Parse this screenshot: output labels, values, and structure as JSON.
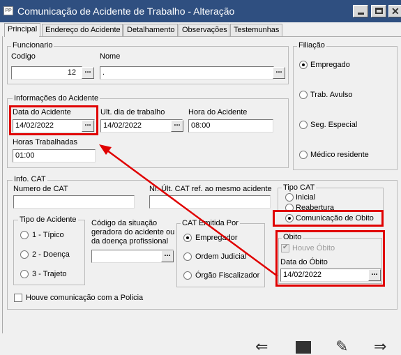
{
  "window": {
    "icon": "PP",
    "title": "Comunicação de Acidente de Trabalho - Alteração",
    "colors": {
      "titlebar": "#2f4f80",
      "highlight": "#e00000"
    }
  },
  "tabs": [
    "Principal",
    "Endereço do Acidente",
    "Detalhamento",
    "Observações",
    "Testemunhas"
  ],
  "funcionario": {
    "title": "Funcionario",
    "codigo_label": "Codigo",
    "codigo_value": "12",
    "nome_label": "Nome",
    "nome_value": "."
  },
  "filiacao": {
    "title": "Filiação",
    "options": [
      "Empregado",
      "Trab. Avulso",
      "Seg. Especial",
      "Médico residente"
    ],
    "selected": "Empregado"
  },
  "informacoes": {
    "title": "Informações do Acidente",
    "data_label": "Data do Acidente",
    "data_value": "14/02/2022",
    "ult_label": "Ult. dia de trabalho",
    "ult_value": "14/02/2022",
    "hora_label": "Hora do Acidente",
    "hora_value": "08:00",
    "horas_label": "Horas Trabalhadas",
    "horas_value": "01:00"
  },
  "info_cat": {
    "title": "Info. CAT",
    "numero_label": "Numero de CAT",
    "numero_value": "",
    "nr_label": "Nr. Últ. CAT ref. ao mesmo acidente",
    "nr_value": "",
    "tipo_acidente": {
      "title": "Tipo de Acidente",
      "options": [
        "1 - Típico",
        "2 - Doença",
        "3 - Trajeto"
      ]
    },
    "codigo_situacao": {
      "label_lines": [
        "Código da situação",
        "geradora do acidente ou",
        "da doença profissional"
      ],
      "value": ""
    },
    "cat_emitida": {
      "title": "CAT Emitida Por",
      "options": [
        "Empregador",
        "Ordem Judicial",
        "Órgão Fiscalizador"
      ],
      "selected": "Empregador"
    },
    "policia_label": "Houve comunicação com a Policia"
  },
  "tipo_cat": {
    "title": "Tipo CAT",
    "options": [
      "Inicial",
      "Reabertura",
      "Comunicação de Obito"
    ],
    "selected": "Comunicação de Obito"
  },
  "obito": {
    "title": "Obito",
    "houve_label": "Houve Óbito",
    "houve_checked": true,
    "data_label": "Data do Óbito",
    "data_value": "14/02/2022"
  },
  "toolbar_icons": [
    "arrow-left-icon",
    "save-icon",
    "edit-document-icon",
    "arrow-right-icon"
  ]
}
